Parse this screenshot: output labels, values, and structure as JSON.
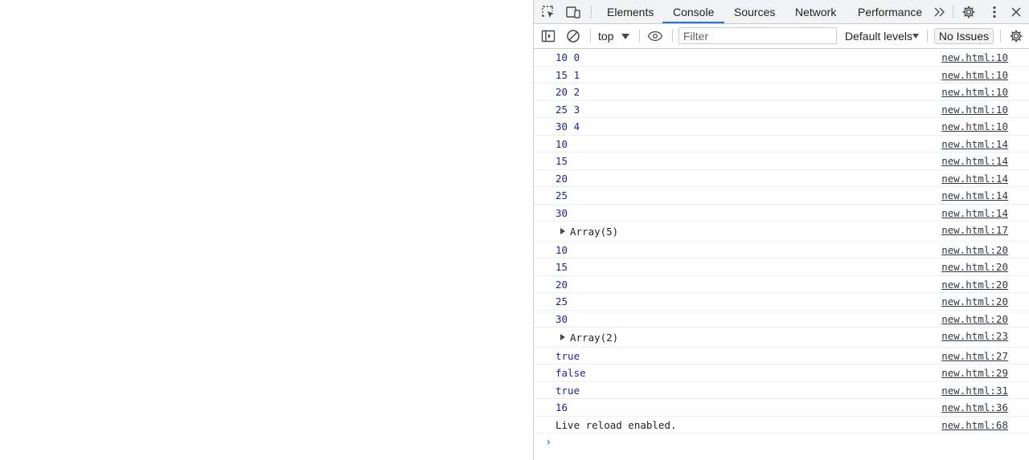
{
  "devtools": {
    "tabs": [
      {
        "label": "Elements",
        "active": false
      },
      {
        "label": "Console",
        "active": true
      },
      {
        "label": "Sources",
        "active": false
      },
      {
        "label": "Network",
        "active": false
      },
      {
        "label": "Performance",
        "active": false
      }
    ],
    "more_tabs_icon": "double-chevron-right-icon",
    "settings_icon": "gear-icon",
    "menu_icon": "kebab-menu-icon",
    "close_icon": "close-icon",
    "inspect_icon": "inspect-element-icon",
    "device_icon": "device-toolbar-icon",
    "accent_color": "#1a73e8"
  },
  "console_toolbar": {
    "sidebar_icon": "sidebar-toggle-icon",
    "clear_icon": "clear-console-icon",
    "context": "top",
    "eye_icon": "live-expression-eye-icon",
    "filter_placeholder": "Filter",
    "levels": "Default levels",
    "issues": "No Issues",
    "settings_icon": "gear-icon"
  },
  "console_messages": [
    {
      "text": "10 0",
      "source": "new.html:10",
      "kind": "number"
    },
    {
      "text": "15 1",
      "source": "new.html:10",
      "kind": "number"
    },
    {
      "text": "20 2",
      "source": "new.html:10",
      "kind": "number"
    },
    {
      "text": "25 3",
      "source": "new.html:10",
      "kind": "number"
    },
    {
      "text": "30 4",
      "source": "new.html:10",
      "kind": "number"
    },
    {
      "text": "10",
      "source": "new.html:14",
      "kind": "number"
    },
    {
      "text": "15",
      "source": "new.html:14",
      "kind": "number"
    },
    {
      "text": "20",
      "source": "new.html:14",
      "kind": "number"
    },
    {
      "text": "25",
      "source": "new.html:14",
      "kind": "number"
    },
    {
      "text": "30",
      "source": "new.html:14",
      "kind": "number"
    },
    {
      "text": "Array(5)",
      "source": "new.html:17",
      "kind": "object"
    },
    {
      "text": "10",
      "source": "new.html:20",
      "kind": "number"
    },
    {
      "text": "15",
      "source": "new.html:20",
      "kind": "number"
    },
    {
      "text": "20",
      "source": "new.html:20",
      "kind": "number"
    },
    {
      "text": "25",
      "source": "new.html:20",
      "kind": "number"
    },
    {
      "text": "30",
      "source": "new.html:20",
      "kind": "number"
    },
    {
      "text": "Array(2)",
      "source": "new.html:23",
      "kind": "object"
    },
    {
      "text": "true",
      "source": "new.html:27",
      "kind": "number"
    },
    {
      "text": "false",
      "source": "new.html:29",
      "kind": "number"
    },
    {
      "text": "true",
      "source": "new.html:31",
      "kind": "number"
    },
    {
      "text": "16",
      "source": "new.html:36",
      "kind": "number"
    },
    {
      "text": "Live reload enabled.",
      "source": "new.html:68",
      "kind": "plain"
    }
  ],
  "prompt_icon": "console-prompt-chevron-icon"
}
